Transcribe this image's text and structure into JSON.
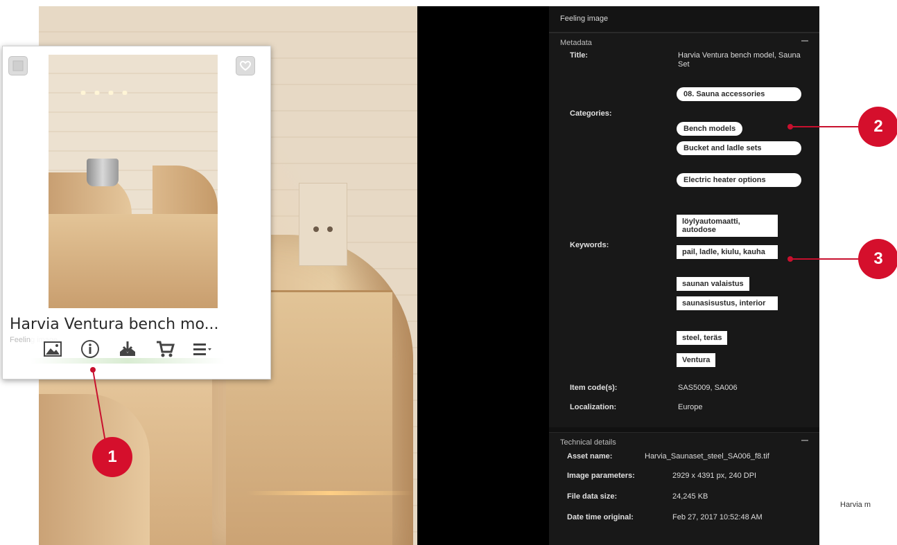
{
  "panel": {
    "header": "Feeling image",
    "metadata": {
      "section_title": "Metadata",
      "title_label": "Title:",
      "title_value": "Harvia Ventura bench model, Sauna Set",
      "categories_label": "Categories:",
      "categories": [
        "08. Sauna accessories",
        "Bench models",
        "Bucket and ladle sets",
        "Electric heater options"
      ],
      "keywords_label": "Keywords:",
      "keywords": [
        "löylyautomaatti, autodose",
        "pail, ladle, kiulu, kauha",
        "saunan valaistus",
        "saunasisustus, interior",
        "steel, teräs",
        "Ventura"
      ],
      "item_code_label": "Item code(s):",
      "item_code_value": "SAS5009, SA006",
      "localization_label": "Localization:",
      "localization_value": "Europe"
    },
    "technical": {
      "section_title": "Technical details",
      "asset_name_label": "Asset name:",
      "asset_name_value": "Harvia_Saunaset_steel_SA006_f8.tif",
      "image_params_label": "Image parameters:",
      "image_params_value": "2929 x 4391 px, 240 DPI",
      "file_size_label": "File data size:",
      "file_size_value": "24,245 KB",
      "date_label": "Date time original:",
      "date_value": "Feb 27, 2017 10:52:48 AM"
    }
  },
  "card": {
    "title": "Harvia Ventura bench mo...",
    "subtitle": "Feeling image",
    "actions": [
      "image-icon",
      "info-icon",
      "download-icon",
      "cart-icon",
      "menu-icon"
    ]
  },
  "callouts": [
    "1",
    "2",
    "3"
  ],
  "footer": "Harvia m",
  "colors": {
    "accent": "#d50f2c",
    "panel_bg": "#111111"
  }
}
